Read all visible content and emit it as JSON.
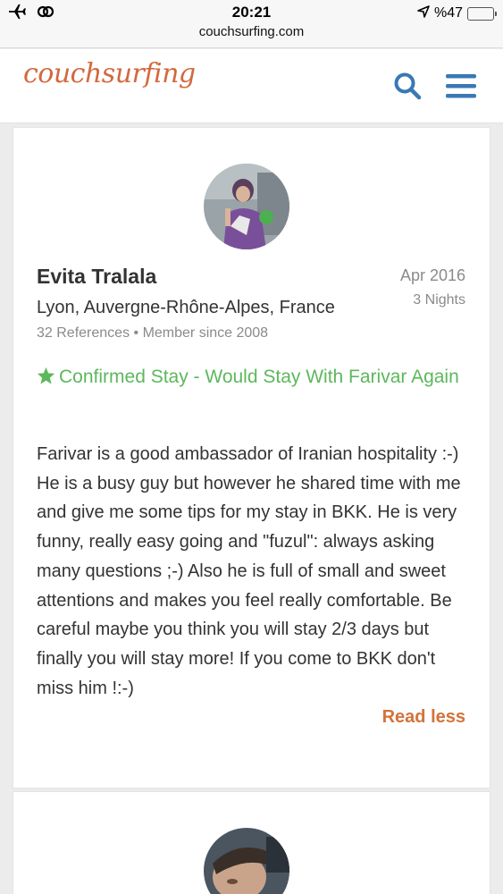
{
  "status_bar": {
    "time": "20:21",
    "url": "couchsurfing.com",
    "battery_text": "%47",
    "battery_level": 0.47,
    "icons": [
      "airplane-icon",
      "link-icon",
      "location-arrow-icon",
      "battery-icon"
    ]
  },
  "header": {
    "logo_text": "couchsurfing",
    "brand_color": "#d2693e",
    "icon_color": "#3a78b5",
    "icons": [
      "search-icon",
      "hamburger-menu-icon"
    ]
  },
  "reference": {
    "name": "Evita Tralala",
    "location": "Lyon, Auvergne-Rhône-Alpes, France",
    "references_count": "32 References",
    "member_since": "Member since 2008",
    "date": "Apr 2016",
    "nights": "3 Nights",
    "confirmed_text": "Confirmed Stay - Would Stay With Farivar Again",
    "confirmed_color": "#5cb85c",
    "review_text": "Farivar is a good ambassador of Iranian hospitality :-) He is a busy guy but however he shared time with me and give me some tips for my stay in BKK. He is very funny, really easy going and \"fuzul\": always asking many questions ;-) Also he is full of small and sweet attentions and makes you feel really comfortable. Be careful maybe you think you will stay 2/3 days but finally you will stay more! If you come to BKK don't miss him !:-)",
    "read_less_label": "Read less",
    "read_less_color": "#d2733a"
  }
}
